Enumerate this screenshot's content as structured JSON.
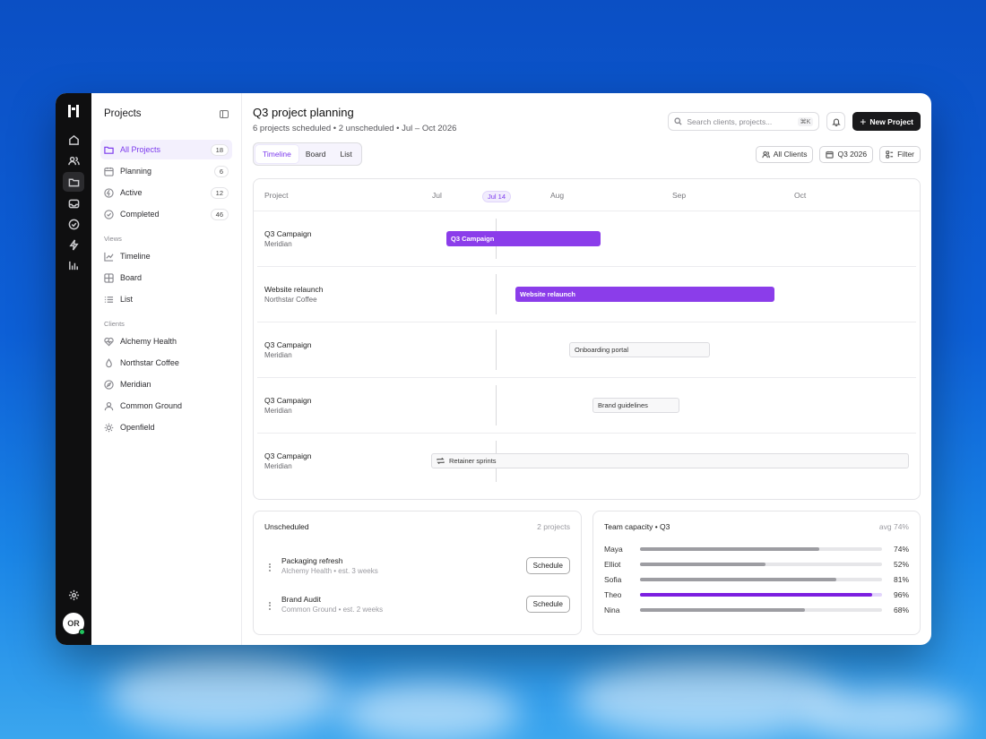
{
  "sidebar": {
    "title": "Projects",
    "projects": [
      {
        "label": "All Projects",
        "count": "18"
      },
      {
        "label": "Planning",
        "count": "6"
      },
      {
        "label": "Active",
        "count": "12"
      },
      {
        "label": "Completed",
        "count": "46"
      }
    ],
    "views_heading": "Views",
    "views": [
      "Timeline",
      "Board",
      "List"
    ],
    "clients_heading": "Clients",
    "clients": [
      "Alchemy Health",
      "Northstar Coffee",
      "Meridian",
      "Common Ground",
      "Openfield"
    ]
  },
  "user": {
    "initials": "OR"
  },
  "header": {
    "title": "Q3 project planning",
    "subtitle": "6 projects scheduled • 2 unscheduled • Jul – Oct 2026",
    "search_placeholder": "Search clients, projects...",
    "search_shortcut": "⌘K",
    "new_project": "New Project"
  },
  "tabs": [
    "Timeline",
    "Board",
    "List"
  ],
  "filters": {
    "clients": "All Clients",
    "quarter": "Q3 2026",
    "filter": "Filter"
  },
  "timeline": {
    "column_project": "Project",
    "months": [
      "Jul",
      "Aug",
      "Sep",
      "Oct"
    ],
    "today_label": "Jul 14",
    "rows": [
      {
        "project": "Q3 Campaign",
        "client": "Meridian",
        "bar": "Q3 Campaign",
        "style": "filled"
      },
      {
        "project": "Website relaunch",
        "client": "Northstar Coffee",
        "bar": "Website relaunch",
        "style": "filled"
      },
      {
        "project": "Q3 Campaign",
        "client": "Meridian",
        "bar": "Onboarding portal",
        "style": "outline"
      },
      {
        "project": "Q3 Campaign",
        "client": "Meridian",
        "bar": "Brand guidelines",
        "style": "outline"
      },
      {
        "project": "Q3 Campaign",
        "client": "Meridian",
        "bar": "Retainer sprints",
        "style": "outline"
      }
    ]
  },
  "unscheduled": {
    "title": "Unscheduled",
    "meta": "2 projects",
    "items": [
      {
        "name": "Packaging refresh",
        "detail": "Alchemy Health • est. 3 weeks",
        "action": "Schedule"
      },
      {
        "name": "Brand Audit",
        "detail": "Common Ground • est. 2 weeks",
        "action": "Schedule"
      }
    ]
  },
  "capacity": {
    "title": "Team capacity • Q3",
    "meta": "avg 74%",
    "highlight_color": "#7c1fe0",
    "members": [
      {
        "name": "Maya",
        "pct": "74%",
        "value": 0.74
      },
      {
        "name": "Elliot",
        "pct": "52%",
        "value": 0.52
      },
      {
        "name": "Sofia",
        "pct": "81%",
        "value": 0.81
      },
      {
        "name": "Theo",
        "pct": "96%",
        "value": 0.96
      },
      {
        "name": "Nina",
        "pct": "68%",
        "value": 0.68
      }
    ]
  }
}
